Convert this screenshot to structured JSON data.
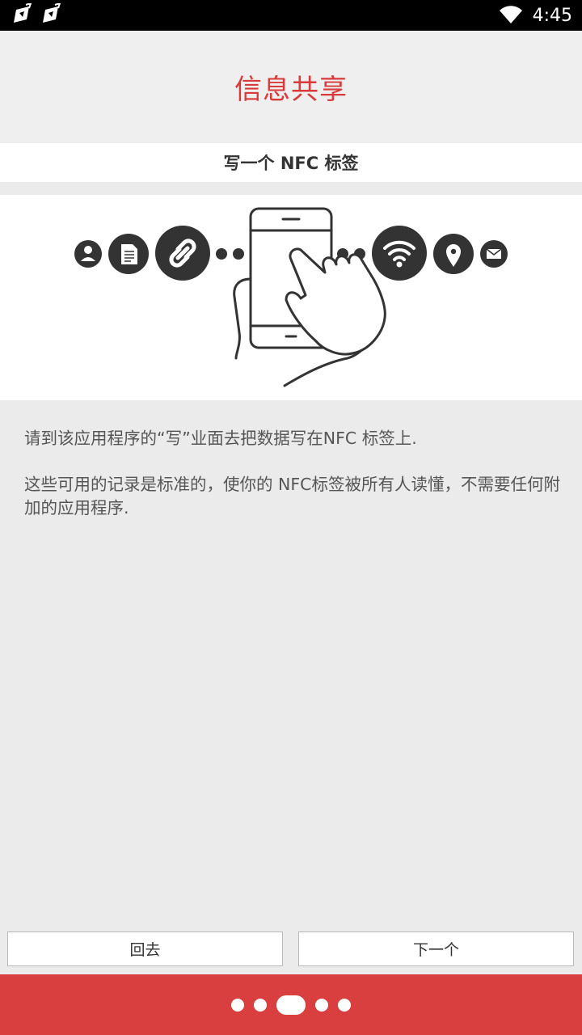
{
  "status_bar": {
    "time": "4:45",
    "icons": [
      "app-notification-icon",
      "app-notification-icon",
      "wifi-icon"
    ]
  },
  "header": {
    "title": "信息共享"
  },
  "section": {
    "subtitle": "写一个 NFC 标签"
  },
  "illustration": {
    "icons": [
      "person-icon",
      "document-icon",
      "link-icon",
      "wifi-icon",
      "location-pin-icon",
      "email-icon"
    ]
  },
  "description": {
    "line1": "请到该应用程序的“写”业面去把数据写在NFC 标签上.",
    "line2": "这些可用的记录是标准的，使你的 NFC标签被所有人读懂，不需要任何附加的应用程序."
  },
  "buttons": {
    "back": "回去",
    "next": "下一个"
  },
  "pager": {
    "count": 5,
    "active_index": 2
  },
  "colors": {
    "accent": "#d93a3a",
    "footer": "#d93f3f",
    "icon_dark": "#333333"
  }
}
